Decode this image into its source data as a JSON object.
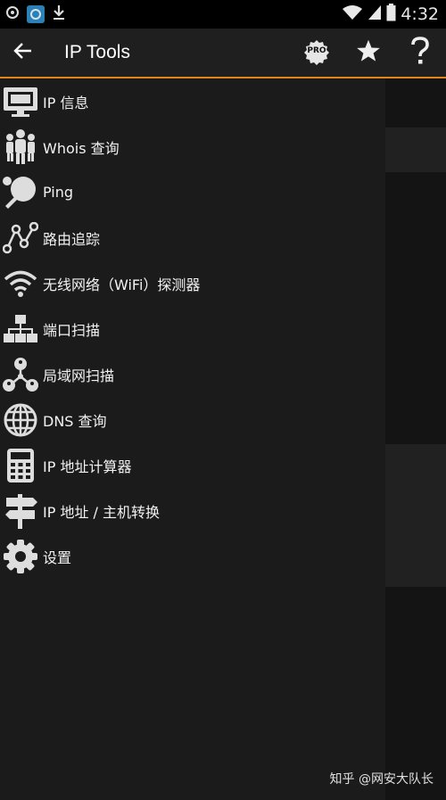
{
  "status_bar": {
    "time": "4:32",
    "icons": [
      "settings-gear-icon",
      "app-thumbnail-icon",
      "download-icon",
      "wifi-icon",
      "signal-icon",
      "battery-icon"
    ]
  },
  "app_bar": {
    "title": "IP Tools",
    "pro_badge": "PRO",
    "accent_color": "#e0851c",
    "actions": [
      "back-arrow-icon",
      "pro-icon",
      "star-icon",
      "help-icon"
    ]
  },
  "drawer": {
    "items": [
      {
        "label": "IP 信息",
        "icon": "monitor-icon"
      },
      {
        "label": "Whois 查询",
        "icon": "people-icon"
      },
      {
        "label": "Ping",
        "icon": "ping-pong-icon"
      },
      {
        "label": "路由追踪",
        "icon": "route-graph-icon"
      },
      {
        "label": "无线网络（WiFi）探测器",
        "icon": "wifi-icon"
      },
      {
        "label": "端口扫描",
        "icon": "network-tree-icon"
      },
      {
        "label": "局域网扫描",
        "icon": "lan-nodes-icon"
      },
      {
        "label": "DNS 查询",
        "icon": "globe-icon"
      },
      {
        "label": "IP 地址计算器",
        "icon": "calculator-icon"
      },
      {
        "label": "IP 地址 / 主机转换",
        "icon": "signpost-icon"
      },
      {
        "label": "设置",
        "icon": "gear-icon"
      }
    ]
  },
  "watermark": "知乎 @网安大队长"
}
